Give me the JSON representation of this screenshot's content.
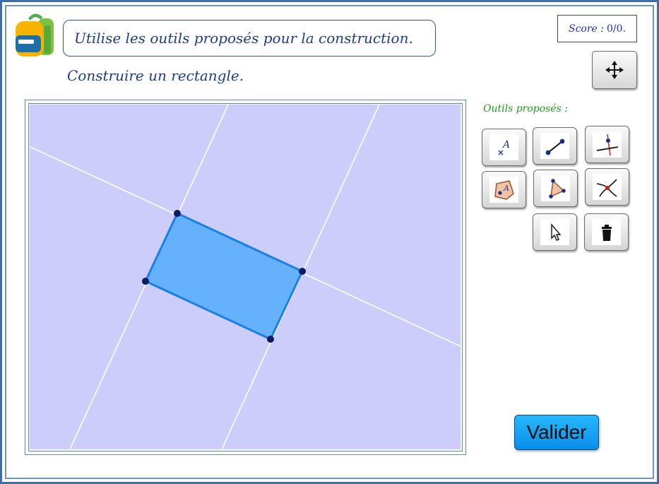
{
  "header": {
    "instruction": "Utilise les outils proposés pour la construction.",
    "task": "Construire un rectangle."
  },
  "score": {
    "label": "Score :",
    "value": "0/0."
  },
  "tools": {
    "label": "Outils proposés :",
    "items": [
      {
        "name": "point",
        "icon": "point-tool-icon"
      },
      {
        "name": "segment",
        "icon": "segment-tool-icon"
      },
      {
        "name": "perpendicular",
        "icon": "perpendicular-line-icon"
      },
      {
        "name": "polygon-point",
        "icon": "point-in-region-icon"
      },
      {
        "name": "polygon",
        "icon": "polygon-tool-icon"
      },
      {
        "name": "intersection",
        "icon": "intersection-tool-icon"
      },
      {
        "name": "pointer",
        "icon": "cursor-icon"
      },
      {
        "name": "delete",
        "icon": "trash-icon"
      }
    ]
  },
  "actions": {
    "validate_label": "Valider",
    "move_icon": "move-arrows-icon"
  },
  "colors": {
    "canvas_bg": "#cccdfb",
    "rectangle_fill": "#66b1fc",
    "rectangle_stroke": "#1a7fe6",
    "lines": "#ffffff",
    "text_blue": "#1c3d8a",
    "tools_label_green": "#1f9a1f",
    "validate_button": "#0a9ff0"
  }
}
